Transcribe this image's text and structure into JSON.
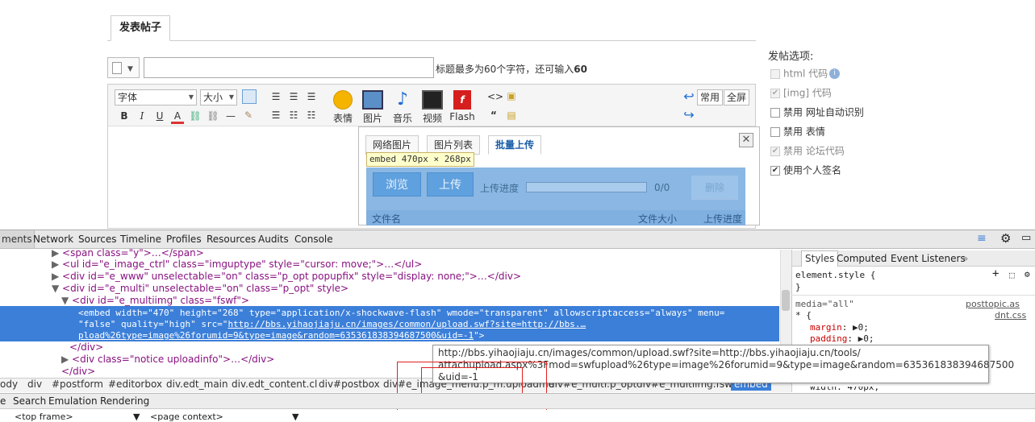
{
  "page": {
    "tab_label": "发表帖子",
    "title_hint_prefix": "标题最多为60个字符，还可输入",
    "title_hint_count": "60",
    "toolbar": {
      "font_select": "字体",
      "size_select": "大小",
      "big_buttons": [
        "表情",
        "图片",
        "音乐",
        "视频",
        "Flash"
      ],
      "common_button": "常用",
      "fullscreen_button": "全屏"
    },
    "dialog": {
      "tabs": [
        "网络图片",
        "图片列表",
        "批量上传"
      ],
      "close": "✕",
      "embed_tooltip": "embed 470px × 268px",
      "browse_button": "浏览",
      "upload_button": "上传",
      "progress_label": "上传进度",
      "progress_count": "0/0",
      "delete_button": "删除",
      "col_filename": "文件名",
      "col_filesize": "文件大小",
      "col_progress": "上传进度"
    },
    "options": {
      "title": "发帖选项:",
      "items": [
        {
          "label": "html 代码",
          "checked": false,
          "disabled": true
        },
        {
          "label": "[img] 代码",
          "checked": true,
          "disabled": true
        },
        {
          "label": "禁用 网址自动识别",
          "checked": false,
          "disabled": false
        },
        {
          "label": "禁用 表情",
          "checked": false,
          "disabled": false
        },
        {
          "label": "禁用 论坛代码",
          "checked": true,
          "disabled": true
        },
        {
          "label": "使用个人签名",
          "checked": true,
          "disabled": false
        }
      ]
    }
  },
  "devtools": {
    "panels": [
      "ments",
      "Network",
      "Sources",
      "Timeline",
      "Profiles",
      "Resources",
      "Audits",
      "Console"
    ],
    "dom_lines": {
      "l1": "<span class=\"y\">…</span>",
      "l2": "<ul id=\"e_image_ctrl\" class=\"imguptype\" style=\"cursor: move;\">…</ul>",
      "l3": "<div id=\"e_www\" unselectable=\"on\" class=\"p_opt popupfix\" style=\"display: none;\">…</div>",
      "l4": "<div id=\"e_multi\" unselectable=\"on\" class=\"p_opt\" style>",
      "l5": "<div id=\"e_multiimg\" class=\"fswf\">",
      "s1": "<embed width=\"470\" height=\"268\" type=\"application/x-shockwave-flash\" wmode=\"transparent\" allowscriptaccess=\"always\" menu=",
      "s2a": "\"false\" quality=\"high\" src=\"",
      "s2b": "http://bbs.yihaojiaju.cn/images/common/upload.swf?site=http://bbs.…",
      "s3a": "pload%26type=image%26forumid=9&type=image&random=635361838394687500&uid=-1",
      "s3b": "\">",
      "l6": "</div>",
      "l7": "<div class=\"notice uploadinfo\">…</div>",
      "l8": "</div>"
    },
    "url_tooltip": {
      "line1": "http://bbs.yihaojiaju.cn/images/common/upload.swf?site=http://bbs.yihaojiaju.cn/tools/",
      "line2": "attachupload.aspx%3Fmod=swfupload%26type=image%26forumid=9&type=image&random=635361838394687500",
      "line3": "&uid=-1"
    },
    "breadcrumbs": [
      "ody",
      "div",
      "#postform",
      "#editorbox",
      "div.edt_main",
      "div.edt_content.cl",
      "div#postbox",
      "div#e_image_menu.p_m.uploadme",
      "div#e_multi.p_opt",
      "div#e_multiimg.fswf",
      "embed"
    ],
    "styles_tabs": [
      "Styles",
      "Computed",
      "Event Listeners",
      "»"
    ],
    "styles": {
      "element_style": "element.style {",
      "close_brace": "}",
      "media": "media=\"all\"",
      "source1": "posttopic.as",
      "universal": "* {",
      "source2": "dnt.css",
      "prop1": "margin",
      "val1": "0;",
      "prop2": "padding",
      "val2": "0;",
      "partial": "width: 470px;"
    },
    "bottom_tabs": [
      "e",
      "Search",
      "Emulation",
      "Rendering"
    ],
    "frame_select": "<top frame>",
    "context_select": "<page context>"
  }
}
